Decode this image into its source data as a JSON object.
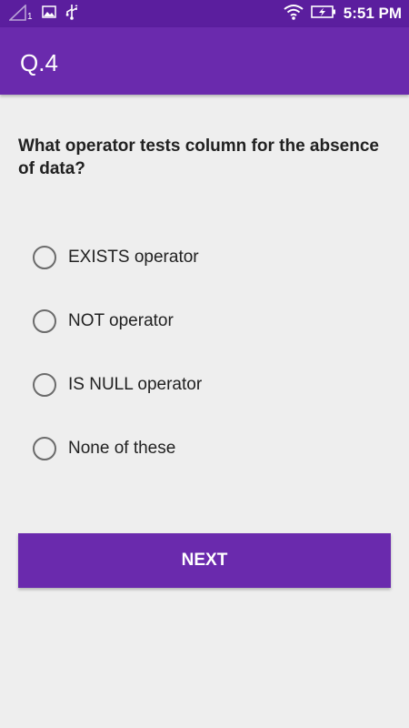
{
  "status_bar": {
    "icons": [
      "signal-icon",
      "image-icon",
      "usb-icon",
      "wifi-icon",
      "battery-charging-icon"
    ],
    "signal_sub": "1",
    "time": "5:51 PM"
  },
  "app_bar": {
    "title": "Q.4"
  },
  "question": {
    "text": "What operator tests column for the absence of data?"
  },
  "options": [
    {
      "label": "EXISTS operator",
      "selected": false
    },
    {
      "label": "NOT operator",
      "selected": false
    },
    {
      "label": "IS NULL operator",
      "selected": false
    },
    {
      "label": "None of these",
      "selected": false
    }
  ],
  "next_button": {
    "label": "NEXT"
  },
  "colors": {
    "status_bar": "#5b1e9e",
    "app_bar": "#6a2aad",
    "background": "#eeeeee",
    "button": "#6a2aad"
  }
}
